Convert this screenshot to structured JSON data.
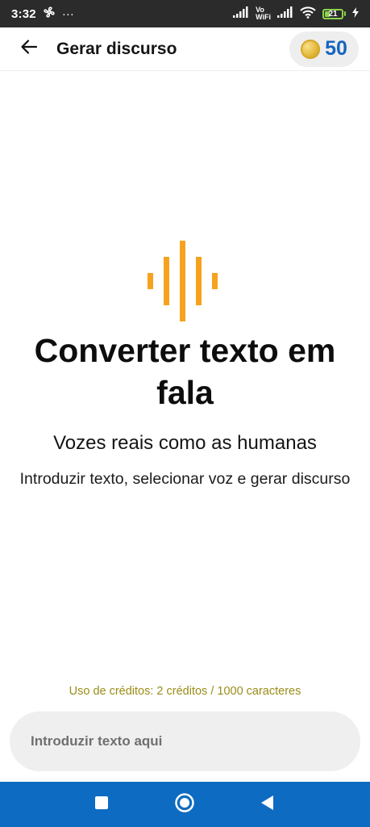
{
  "status_bar": {
    "time": "3:32",
    "more": "···",
    "vowifi_top": "Vo",
    "vowifi_bottom": "WiFi",
    "battery": "21",
    "icons": [
      "fan-icon",
      "signal-icon",
      "wifi-icon",
      "battery-icon",
      "charging-icon"
    ]
  },
  "app_bar": {
    "title": "Gerar discurso",
    "credits": "50",
    "icons": [
      "back-arrow-icon",
      "coin-icon"
    ]
  },
  "hero": {
    "title": "Converter texto em fala",
    "subtitle": "Vozes reais como as humanas",
    "description": "Introduzir texto, selecionar voz e gerar discurso",
    "icon": "soundwave-icon",
    "accent_color": "#f6a21e"
  },
  "footer": {
    "credit_usage": "Uso de créditos: 2 créditos / 1000 caracteres",
    "input_placeholder": "Introduzir texto aqui",
    "input_value": ""
  },
  "nav_bar": {
    "color": "#0d6bc1",
    "icons": [
      "recents-square-icon",
      "home-circle-icon",
      "back-triangle-icon"
    ]
  }
}
